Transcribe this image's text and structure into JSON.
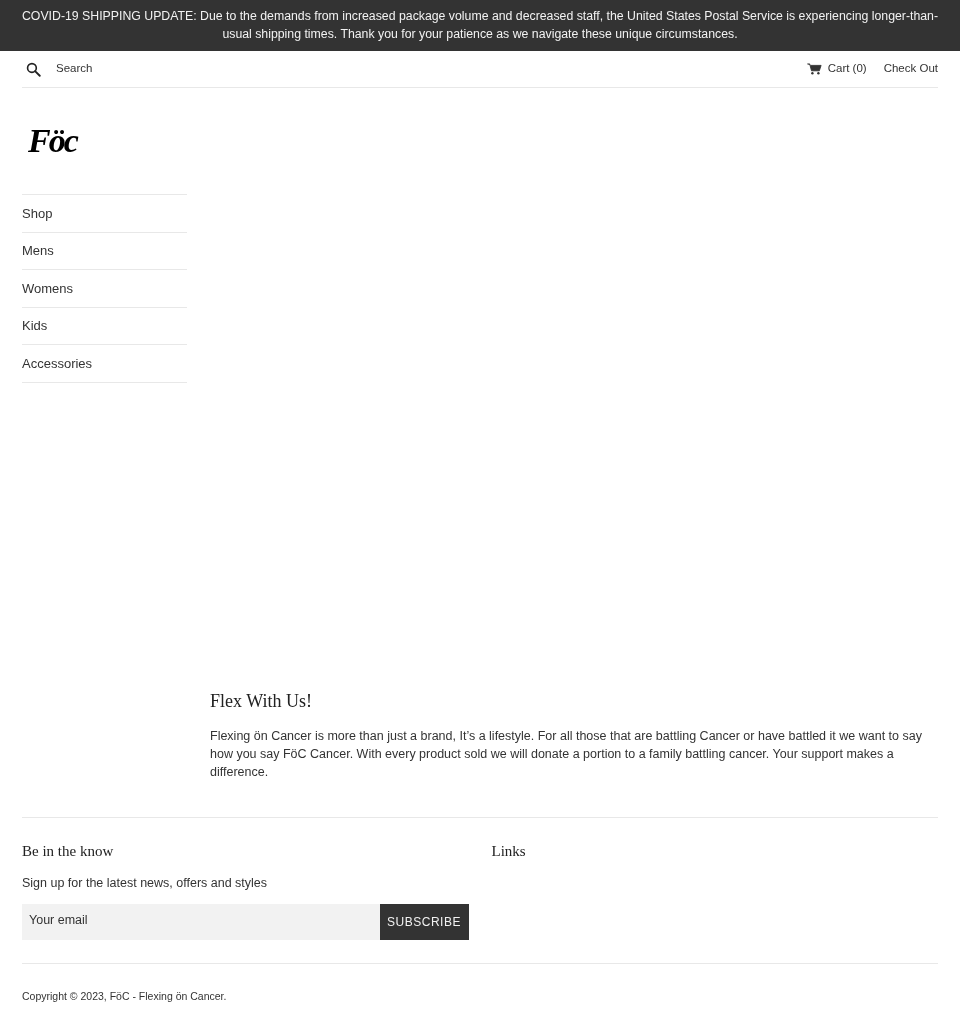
{
  "banner": {
    "text": "COVID-19 SHIPPING UPDATE: Due to the demands from increased package volume and decreased staff, the United States Postal Service is experiencing longer-than-usual shipping times. Thank you for your patience as we navigate these unique circumstances."
  },
  "header": {
    "search": {
      "placeholder": "Search"
    },
    "cart": "Cart (0)",
    "checkout": "Check Out"
  },
  "logo": {
    "text": "Föc"
  },
  "sidebar": {
    "items": [
      {
        "label": "Shop"
      },
      {
        "label": "Mens"
      },
      {
        "label": "Womens"
      },
      {
        "label": "Kids"
      },
      {
        "label": "Accessories"
      }
    ]
  },
  "main": {
    "heading": "Flex With Us!",
    "paragraph": "Flexing ön Cancer is more than just a brand, It’s a lifestyle. For all those that are battling Cancer or have battled it we want to say how you say FöC Cancer. With every product sold we will donate a portion to a family battling cancer. Your support makes a difference."
  },
  "footer": {
    "newsletter": {
      "heading": "Be in the know",
      "text": "Sign up for the latest news, offers and styles",
      "email": {
        "placeholder": "Your email"
      },
      "button": "SUBSCRIBE"
    },
    "links": {
      "heading": "Links"
    },
    "copyright": "Copyright © 2023, FöC - Flexing ön Cancer."
  }
}
